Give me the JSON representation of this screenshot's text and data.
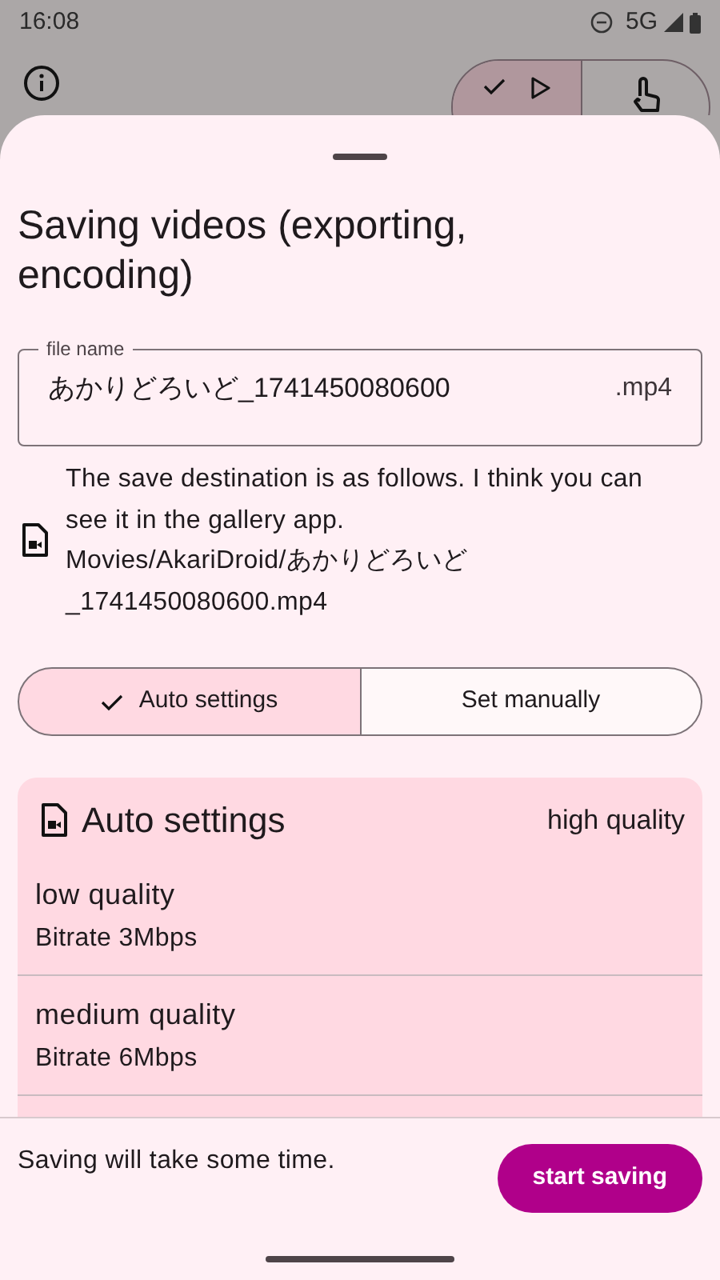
{
  "status_bar": {
    "time": "16:08",
    "network": "5G"
  },
  "toolbar": {
    "toggle": [
      {
        "kind": "check-play",
        "selected": true
      },
      {
        "kind": "touch",
        "selected": false
      }
    ]
  },
  "sheet": {
    "title": "Saving videos (exporting, encoding)",
    "file_name": {
      "label": "file name",
      "value": "あかりどろいど_1741450080600",
      "suffix": ".mp4"
    },
    "destination": "The save destination is as follows. I think you can see it in the gallery app.\nMovies/AkariDroid/あかりどろいど\n_1741450080600.mp4",
    "mode_tabs": [
      {
        "label": "Auto settings",
        "selected": true
      },
      {
        "label": "Set manually",
        "selected": false
      }
    ],
    "auto_card": {
      "title": "Auto settings",
      "current": "high quality",
      "options": [
        {
          "title": "low quality",
          "subtitle": "Bitrate 3Mbps"
        },
        {
          "title": "medium quality",
          "subtitle": "Bitrate 6Mbps"
        }
      ]
    },
    "footer_note": "Saving will take some time.",
    "start_button": "start saving"
  }
}
